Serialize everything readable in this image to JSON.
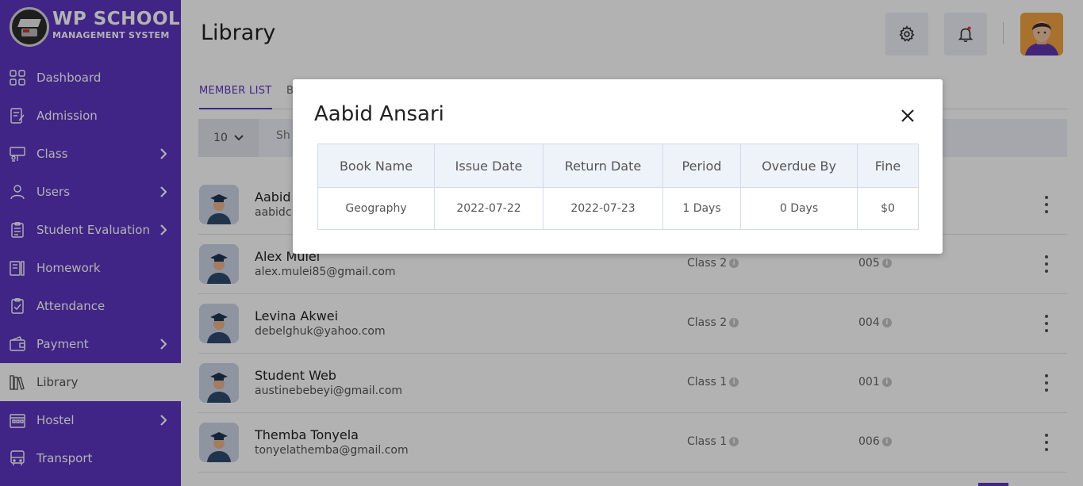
{
  "app": {
    "logo_line1": "WP SCHOOL",
    "logo_line2": "MANAGEMENT SYSTEM"
  },
  "sidebar": {
    "items": [
      {
        "label": "Dashboard"
      },
      {
        "label": "Admission"
      },
      {
        "label": "Class"
      },
      {
        "label": "Users"
      },
      {
        "label": "Student Evaluation"
      },
      {
        "label": "Homework"
      },
      {
        "label": "Attendance"
      },
      {
        "label": "Payment"
      },
      {
        "label": "Library"
      },
      {
        "label": "Hostel"
      },
      {
        "label": "Transport"
      }
    ]
  },
  "header": {
    "title": "Library"
  },
  "tabs": {
    "member_list": "MEMBER LIST",
    "second_partial": "B"
  },
  "toolbar": {
    "page_size": "10",
    "show_partial": "Sh"
  },
  "members": [
    {
      "name": "Aabid",
      "email": "aabidc",
      "class": "",
      "roll": ""
    },
    {
      "name": "Alex Mulei",
      "email": "alex.mulei85@gmail.com",
      "class": "Class 2",
      "roll": "005"
    },
    {
      "name": "Levina Akwei",
      "email": "debelghuk@yahoo.com",
      "class": "Class 2",
      "roll": "004"
    },
    {
      "name": "Student Web",
      "email": "austinebebeyi@gmail.com",
      "class": "Class 1",
      "roll": "001"
    },
    {
      "name": "Themba Tonyela",
      "email": "tonyelathemba@gmail.com",
      "class": "Class 1",
      "roll": "006"
    }
  ],
  "modal": {
    "title": "Aabid Ansari",
    "columns": [
      "Book Name",
      "Issue Date",
      "Return Date",
      "Period",
      "Overdue By",
      "Fine"
    ],
    "rows": [
      [
        "Geography",
        "2022-07-22",
        "2022-07-23",
        "1 Days",
        "0 Days",
        "$0"
      ]
    ]
  },
  "colors": {
    "sidebar": "#5c35c2",
    "accent": "#5c35c2",
    "table_header": "#eef2f9"
  }
}
